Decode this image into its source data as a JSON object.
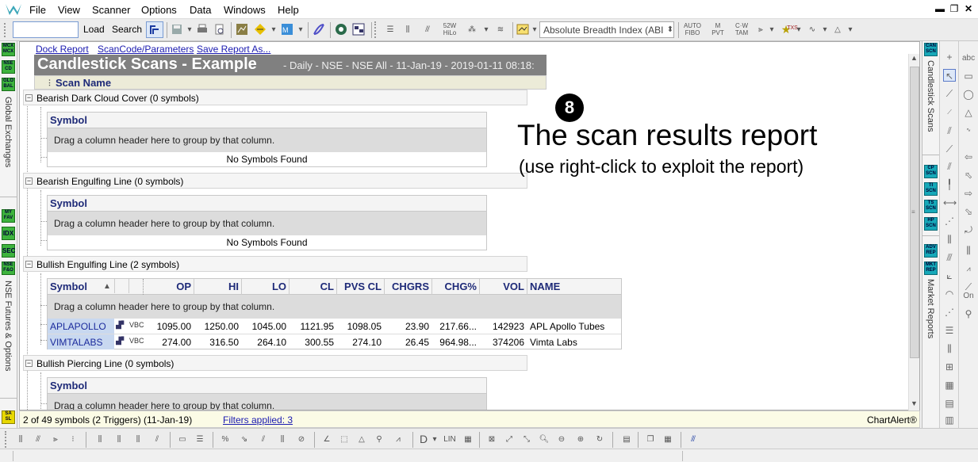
{
  "menu": {
    "items": [
      "File",
      "View",
      "Scanner",
      "Options",
      "Data",
      "Windows",
      "Help"
    ],
    "window_controls": [
      "▬",
      "❐",
      "✕"
    ]
  },
  "toolbar": {
    "search_value": "",
    "load_label": "Load",
    "search_label": "Search",
    "indicator_select": "Absolute Breadth Index (ABI",
    "icon_labels": [
      "52W HiLo",
      "AUTO FIBO",
      "M PVT",
      "C·W TAM",
      "TXS"
    ]
  },
  "left_sidebar": {
    "buttons_top": [
      "MCX MCX",
      "NSE CD",
      "GLO BAL"
    ],
    "label_top": "Global Exchanges",
    "buttons_mid": [
      "MY FAV",
      "IDX",
      "SEC",
      "NSE F&O"
    ],
    "label_mid": "NSE Futures & Options",
    "button_bottom": "SA SL"
  },
  "report": {
    "links": [
      "Dock Report",
      "ScanCode/Parameters",
      "Save Report As..."
    ],
    "title": "Candlestick Scans - Example",
    "subtitle": "- Daily - NSE - NSE All - 11-Jan-19 - 2019-01-11 08:18:",
    "scan_name_header": "Scan Name",
    "drag_text": "Drag a column header here to group by that column.",
    "no_symbols_text": "No Symbols Found",
    "groups": [
      {
        "name": "Bearish Dark Cloud Cover (0 symbols)",
        "toggle": "−"
      },
      {
        "name": "Bearish Engulfing Line (0 symbols)",
        "toggle": "−"
      },
      {
        "name": "Bullish Engulfing Line (2 symbols)",
        "toggle": "−"
      },
      {
        "name": "Bullish Piercing Line (0 symbols)",
        "toggle": "−"
      }
    ],
    "symbol_header": "Symbol",
    "columns": [
      "Symbol",
      "OP",
      "HI",
      "LO",
      "CL",
      "PVS CL",
      "CHGRS",
      "CHG%",
      "VOL",
      "NAME"
    ],
    "sort_indicator": "▲",
    "rows": [
      {
        "symbol": "APLAPOLLO",
        "op": "1095.00",
        "hi": "1250.00",
        "lo": "1045.00",
        "cl": "1121.95",
        "pvs_cl": "1098.05",
        "chgrs": "23.90",
        "chg_pct": "217.66...",
        "vol": "142923",
        "name": "APL Apollo Tubes"
      },
      {
        "symbol": "VIMTALABS",
        "op": "274.00",
        "hi": "316.50",
        "lo": "264.10",
        "cl": "300.55",
        "pvs_cl": "274.10",
        "chgrs": "26.45",
        "chg_pct": "964.98...",
        "vol": "374206",
        "name": "Vimta Labs"
      }
    ],
    "row_icon_label": "VBC"
  },
  "annotation": {
    "number": "8",
    "title": "The scan results report",
    "subtitle": "(use right-click to exploit the report)"
  },
  "status": {
    "summary": "2 of 49 symbols (2 Triggers) (11-Jan-19)",
    "filters_link": "Filters applied: 3",
    "brand": "ChartAlert®"
  },
  "right_sidebar": {
    "buttons_top": [
      "CAN SCN"
    ],
    "label_top": "Candlestick Scans",
    "buttons_mid": [
      "CP SCN",
      "TI SCN",
      "TS SCN",
      "HP SCN"
    ],
    "buttons_bottom": [
      "ADV REP",
      "MKT REP"
    ],
    "label_bottom": "Market Reports"
  },
  "draw_tools": {
    "abc_label": "abc",
    "on_label": "On"
  },
  "bottom_toolbar": {
    "lin_label": "LIN"
  }
}
